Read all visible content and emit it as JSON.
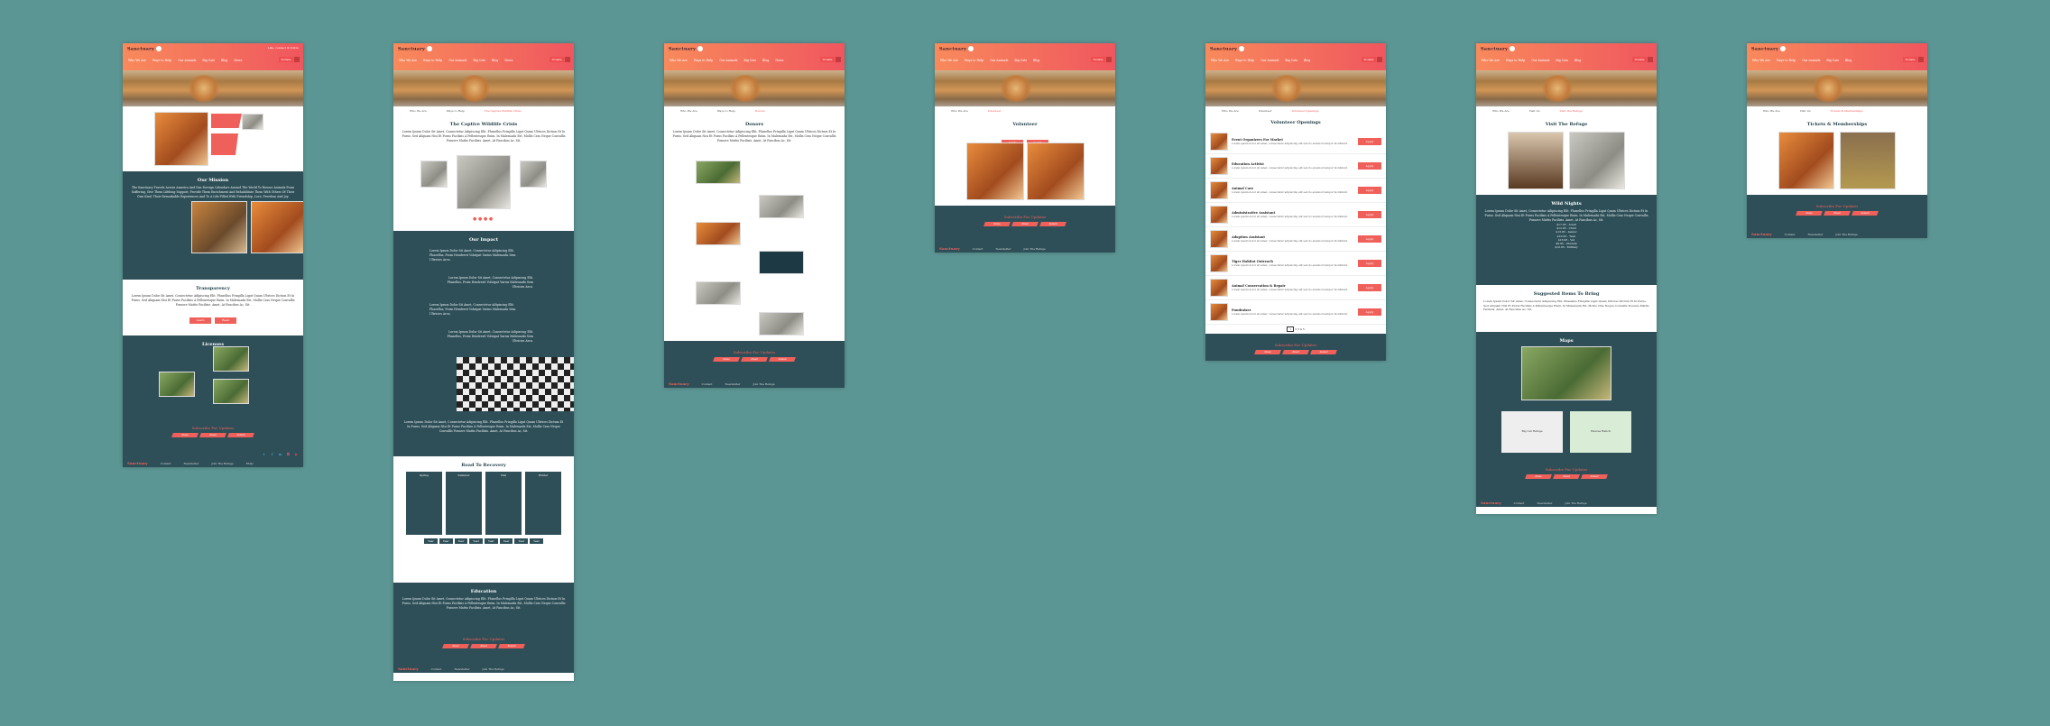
{
  "nav": {
    "logo": "Sanctuary",
    "follow": "Like, connect & follow",
    "menu": [
      "Who We Are",
      "Ways to Help",
      "Our Animals",
      "Big Cats",
      "Blog",
      "News",
      "Shop",
      "Visit Us"
    ],
    "donate": "Donate"
  },
  "home": {
    "mission_title": "Our Mission",
    "mission_text": "The Sanctuary Travels Across America And Has Foreign Calendars Around The World To Rescue Animals From Suffering, Give Them Lifelong Support, Provide Them Enrichment And Rehabilitate Them With Others Of Their Own Kind. Their Remarkable Experiences And To A Life-Filled With Friendship, Love, Freedom And Joy.",
    "transparency_title": "Transparency",
    "transparency_text": "Lorem Ipsum Dolor Sit Amet, Consectetur Adipiscing Elit. Phasellus Fringilla Ligut Quam Ultrices Dictum Et In Purus. Sed Aliquam Nisi Et Purus Facilisis A Pellentesque Enim. In Malesuada Est, Mollis Cras Neque Convallis Posuere Mattis Facilisis. Amet, At Faucibus Ac, Sit.",
    "btn1": "Learn",
    "btn2": "Read",
    "licenses_title": "Licenses"
  },
  "crisis": {
    "title": "The Captive Wildlife Crisis",
    "text": "Lorem Ipsum Dolor Sit Amet, Consectetur Adipiscing Elit. Phasellus Fringilla Ligut Quam Ultrices Dictum Et In Purus. Sed Aliquam Nisi Et Purus Facilisis A Pellentesque Enim. In Malesuada Est, Mollis Cras Neque Convallis Posuere Mattis Facilisis. Amet, At Faucibus Ac, Sit.",
    "impact_title": "Our Impact",
    "impact_text": "Lorem Ipsum Dolor Sit Amet, Consectetur Adipiscing Elit. Phasellus, Proin Hendrerit Volutpat Varius Malesuada Sem Ultricies Arcu.",
    "road_title": "Road To Recovery",
    "seasons": [
      "Spring",
      "Summer",
      "Fall",
      "Winter"
    ],
    "year_label": "Year",
    "education_title": "Education"
  },
  "donors": {
    "title": "Donors",
    "text": "Lorem Ipsum Dolor Sit Amet, Consectetur Adipiscing Elit. Phasellus Fringilla Ligut Quam Ultrices Dictum Et In Purus. Sed Aliquam Nisi Et Purus Facilisis A Pellentesque Enim. In Malesuada Est, Mollis Cras Neque Convallis Posuere Mattis Facilisis. Amet, At Faucibus Ac, Sit."
  },
  "volunteer": {
    "title": "Volunteer",
    "btn1": "Apply",
    "btn2": "Learn"
  },
  "openings": {
    "title": "Volunteer Openings",
    "items": [
      "Event Organizers For Market",
      "Education Activist",
      "Animal Care",
      "Administrative Assistant",
      "Adoption Assistant",
      "Tiger Habitat Outreach",
      "Animal Conservation & Repair",
      "Fundraiser"
    ],
    "item_text": "Lorem ipsum dolor sit amet, consectetur adipiscing elit sed do eiusmod tempor incididunt.",
    "apply": "Apply",
    "pages": [
      "1",
      "2",
      "3",
      "4",
      "5"
    ]
  },
  "visit": {
    "title": "Visit The Refuge",
    "wild_nights": "Wild Nights",
    "prices": [
      "$17.95 - Adult",
      "$12.95 - Child",
      "$13.95 - Senior",
      "$10.95 - Teen",
      "$16.95 - Vet",
      "$9.95 - Student",
      "$10.95 - Military"
    ],
    "suggest_title": "Suggested Items To Bring",
    "maps_title": "Maps",
    "map1": "Big Cat Refuge",
    "map2": "Rescue Ranch"
  },
  "tickets": {
    "title": "Tickets & Memberships"
  },
  "footer": {
    "subscribe": "Subscribe For Updates",
    "buttons": [
      "Name",
      "Email",
      "Submit"
    ],
    "links": [
      "Contact",
      "Newsletter",
      "Join The Refuge",
      "FAQs",
      "Resources"
    ],
    "logo": "Sanctuary"
  }
}
